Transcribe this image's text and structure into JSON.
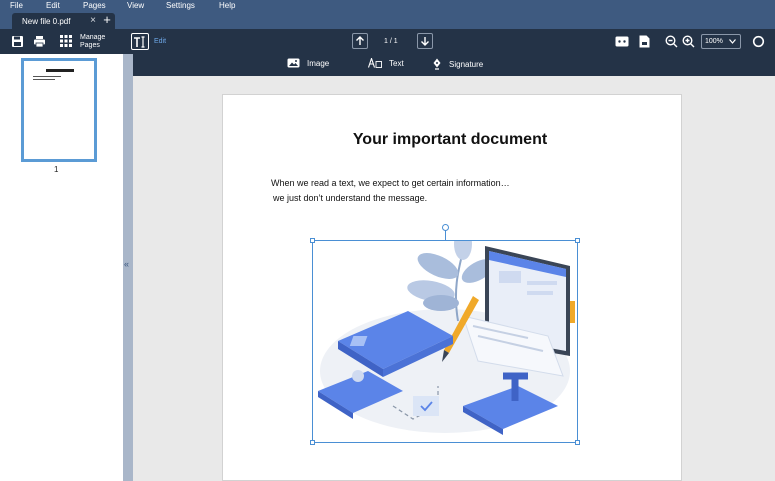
{
  "menu": {
    "file": "File",
    "edit": "Edit",
    "pages": "Pages",
    "view": "View",
    "settings": "Settings",
    "help": "Help"
  },
  "tabs": [
    {
      "label": "New file 0.pdf",
      "close": "×"
    }
  ],
  "tab_add": "+",
  "toolbar": {
    "manage_pages_line1": "Manage",
    "manage_pages_line2": "Pages",
    "edit_label": "Edit",
    "page_indicator": "1 / 1",
    "zoom_value": "100%"
  },
  "edit_tools": {
    "image": "Image",
    "text": "Text",
    "signature": "Signature"
  },
  "thumbnails": [
    {
      "number": "1"
    }
  ],
  "document": {
    "title": "Your important document",
    "line1": "When we read a text, we expect to get certain information…",
    "line2": "we just don’t understand the message."
  },
  "colors": {
    "chrome": "#243347",
    "menubar": "#3e5a80",
    "accent": "#5b9bd5",
    "illustration_blue": "#5b84e8"
  }
}
